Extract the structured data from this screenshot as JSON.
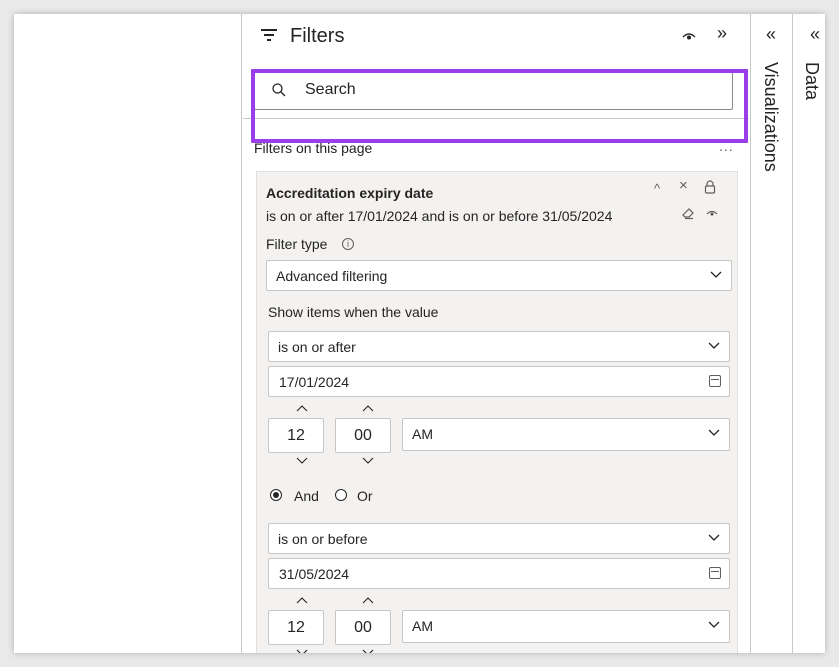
{
  "filters_pane": {
    "title": "Filters",
    "header_icons": [
      "eye-icon",
      "chevron-double-right-icon"
    ],
    "collapse_glyph": "»",
    "search": {
      "placeholder": "Search"
    },
    "section_title": "Filters on this page",
    "section_more": "...",
    "card": {
      "title": "Accreditation expiry date",
      "summary": "is on or after 17/01/2024 and is on or before 31/05/2024",
      "icons": [
        "chevron-up-icon",
        "close-icon",
        "lock-icon",
        "eraser-icon",
        "eye-icon"
      ],
      "glyphs": {
        "up": "^",
        "close": "×"
      },
      "filter_type_label": "Filter type",
      "info_glyph": "i",
      "filter_type_value": "Advanced filtering",
      "show_items_label": "Show items when the value",
      "condition1": {
        "operator": "is on or after",
        "date": "17/01/2024",
        "hour": "12",
        "minute": "00",
        "ampm": "AM"
      },
      "logic": {
        "and_label": "And",
        "or_label": "Or",
        "selected": "And"
      },
      "condition2": {
        "operator": "is on or before",
        "date": "31/05/2024",
        "hour": "12",
        "minute": "00",
        "ampm": "AM"
      }
    }
  },
  "side_tabs": {
    "collapse_glyph": "«",
    "visualizations": "Visualizations",
    "data": "Data"
  },
  "colors": {
    "highlight": "#9b3ee8",
    "card_bg": "#f3f2f1",
    "border": "#c8c6c4",
    "text": "#252423"
  }
}
